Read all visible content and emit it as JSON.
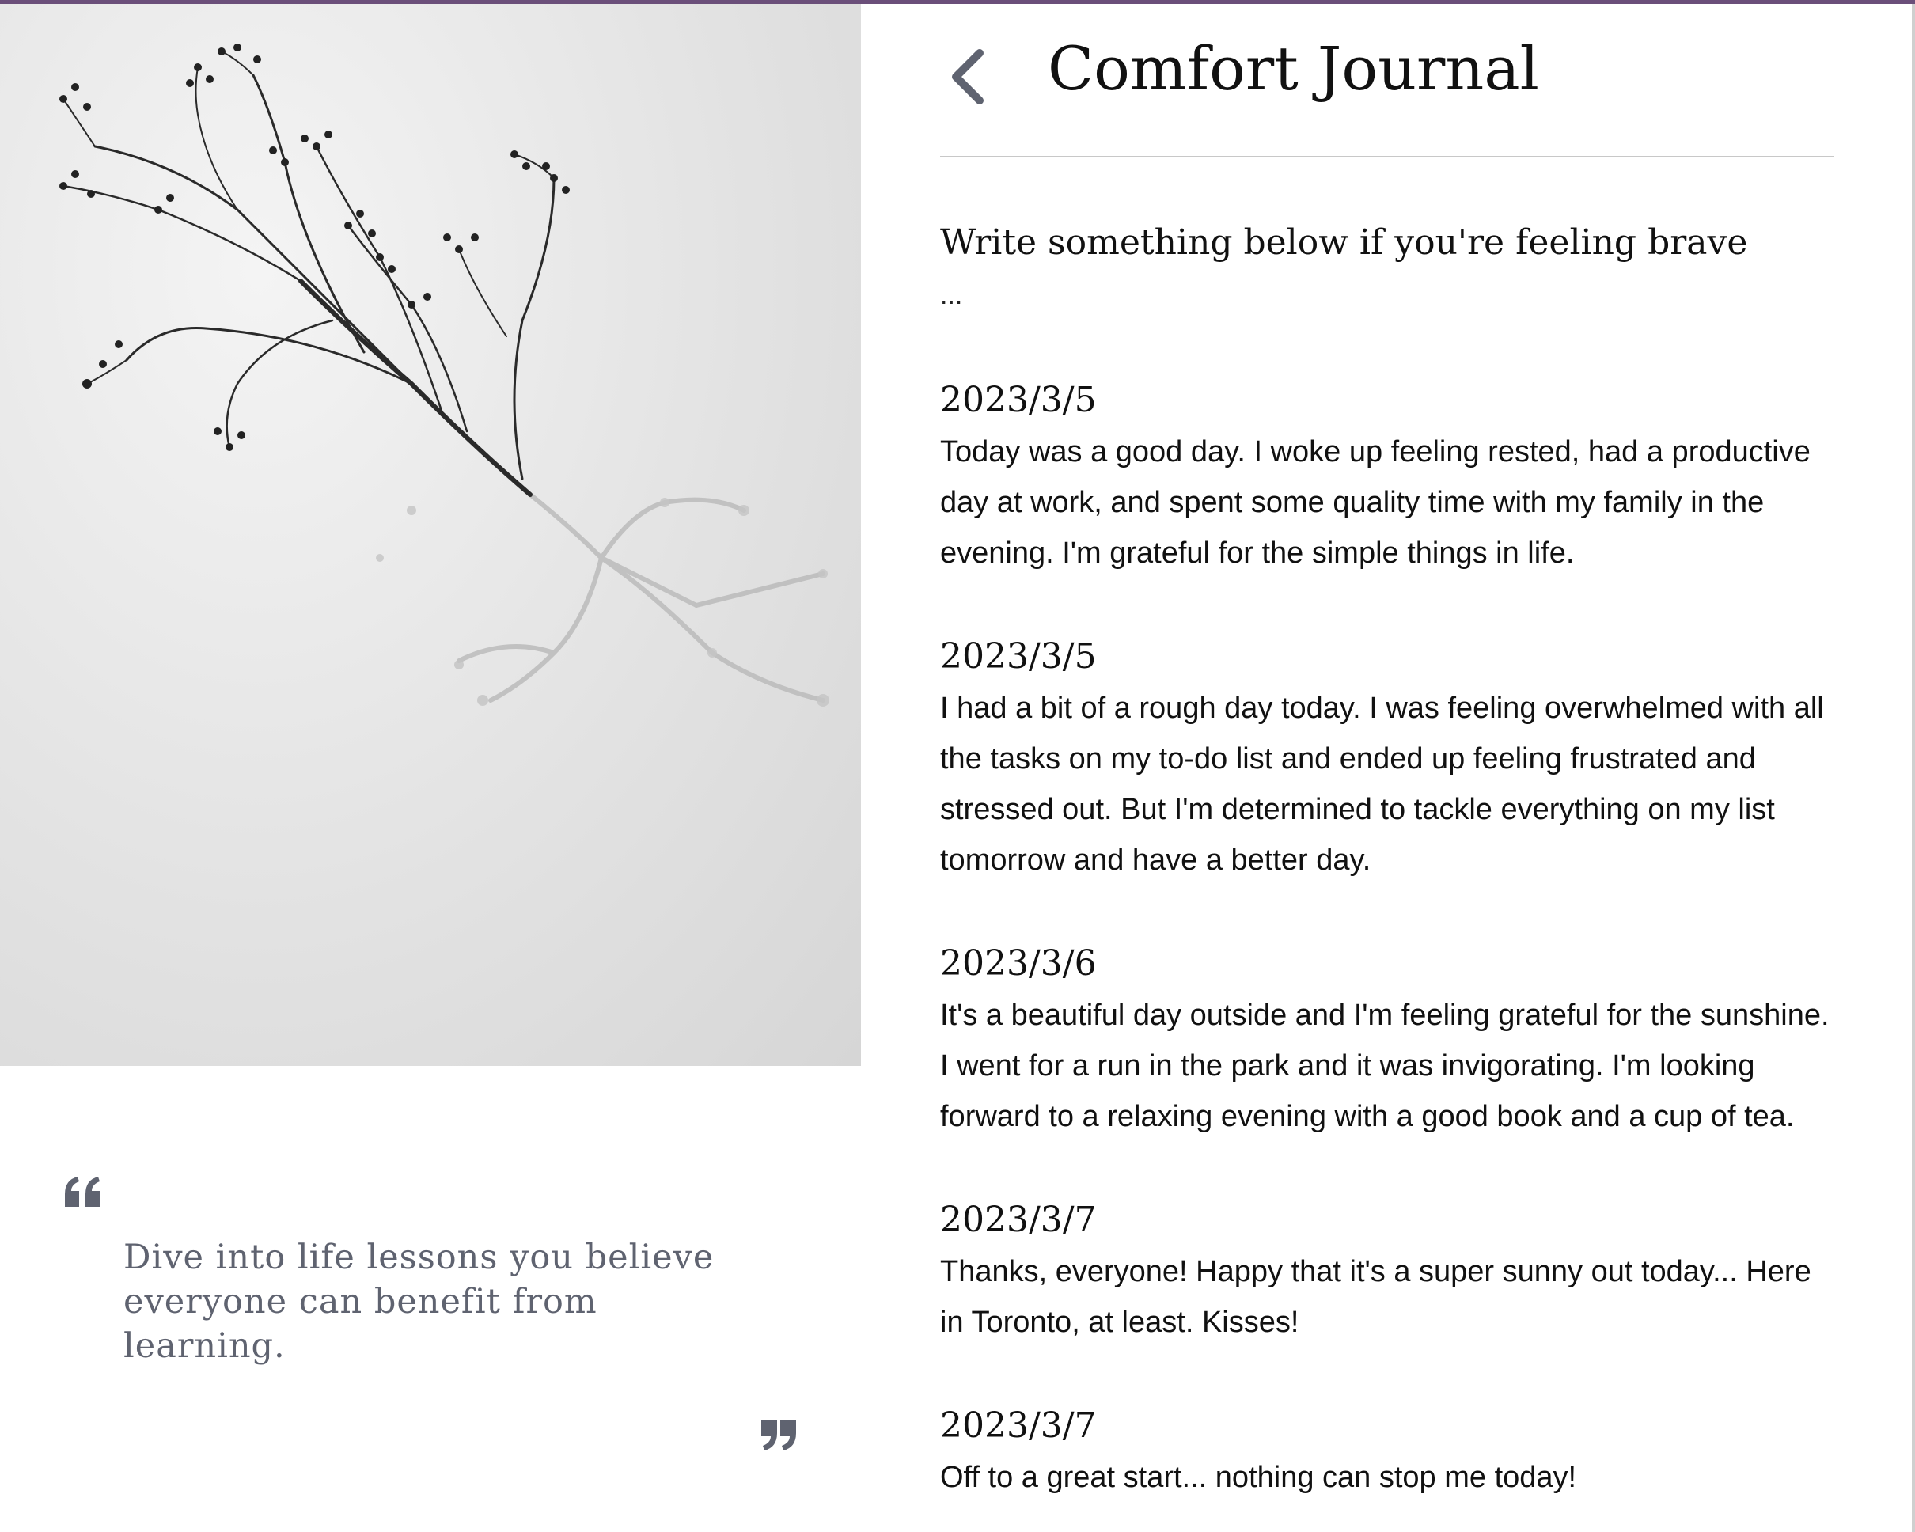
{
  "app": {
    "title": "Comfort Journal",
    "accent_color": "#6b4f7a"
  },
  "header": {
    "back_icon": "chevron-left-icon",
    "title": "Comfort Journal"
  },
  "left_panel": {
    "image_description_icon": "photo",
    "quote_open_icon": "quote-open-icon",
    "quote_close_icon": "quote-close-icon",
    "quote": "Dive into life lessons you believe everyone can benefit from learning.",
    "quote_color": "#5f6370"
  },
  "compose": {
    "prompt": "Write something below if you're feeling brave",
    "input_value": "..."
  },
  "entries": [
    {
      "date": "2023/3/5",
      "text": "Today was a good day. I woke up feeling rested, had a productive day at work, and spent some quality time with my family in the evening. I'm grateful for the simple things in life."
    },
    {
      "date": "2023/3/5",
      "text": "I had a bit of a rough day today. I was feeling overwhelmed with all the tasks on my to-do list and ended up feeling frustrated and stressed out. But I'm determined to tackle everything on my list tomorrow and have a better day."
    },
    {
      "date": "2023/3/6",
      "text": "It's a beautiful day outside and I'm feeling grateful for the sunshine. I went for a run in the park and it was invigorating. I'm looking forward to a relaxing evening with a good book and a cup of tea."
    },
    {
      "date": "2023/3/7",
      "text": "Thanks, everyone! Happy that it's a super sunny out today... Here in Toronto, at least. Kisses!"
    },
    {
      "date": "2023/3/7",
      "text": "Off to a great start... nothing can stop me today!"
    }
  ]
}
